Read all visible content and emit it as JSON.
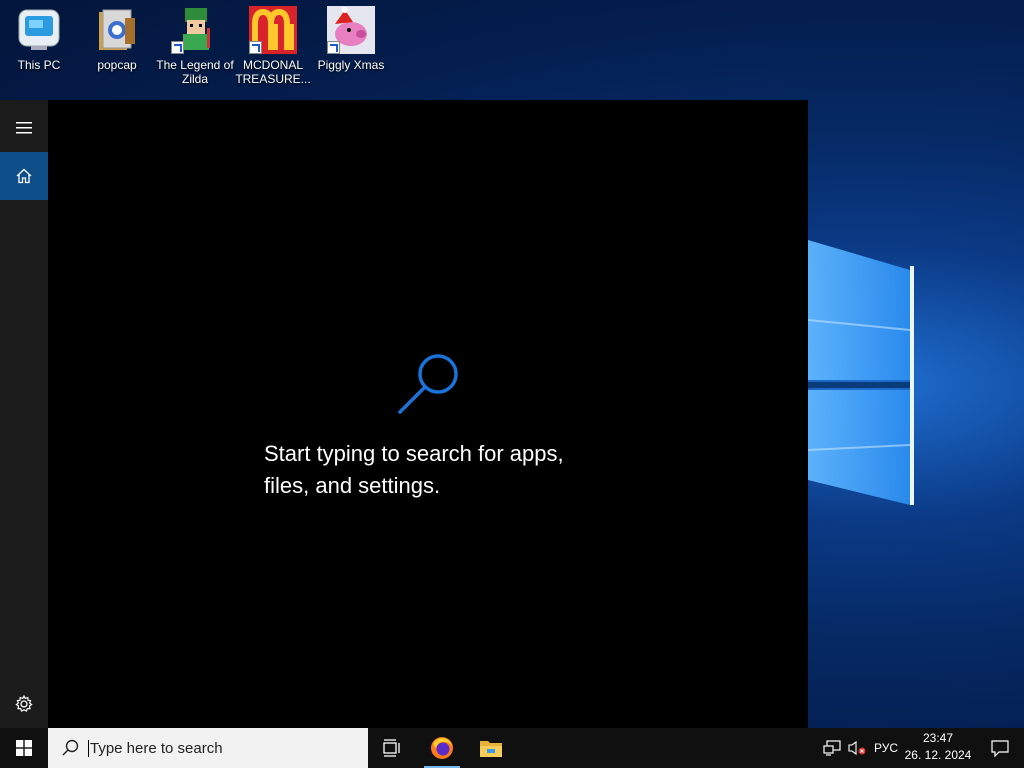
{
  "desktop": {
    "icons": [
      {
        "label": "This PC"
      },
      {
        "label": "popcap"
      },
      {
        "label": "The Legend of Zilda"
      },
      {
        "label": "MCDONAL TREASURE..."
      },
      {
        "label": "Piggly Xmas"
      }
    ]
  },
  "search_flyout": {
    "prompt_line1": "Start typing to search for apps,",
    "prompt_line2": "files, and settings."
  },
  "taskbar": {
    "search_placeholder": "Type here to search",
    "language": "РУС",
    "time": "23:47",
    "date": "26. 12. 2024"
  },
  "colors": {
    "accent": "#0e4f8a",
    "taskbar": "#101010",
    "flyout_bg": "#000000",
    "search_icon_blue": "#1a73d9"
  },
  "icons": [
    "windows-logo-icon",
    "search-icon",
    "hamburger-icon",
    "home-icon",
    "settings-icon",
    "task-view-icon",
    "firefox-icon",
    "file-explorer-icon",
    "network-icon",
    "volume-muted-icon",
    "notification-icon"
  ]
}
